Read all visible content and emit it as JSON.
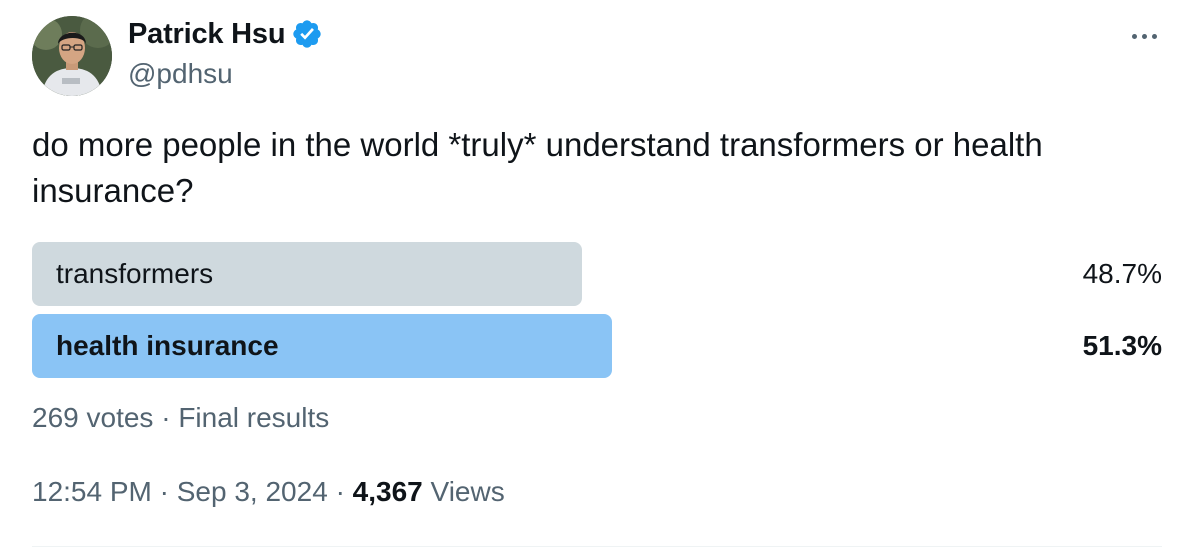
{
  "author": {
    "display_name": "Patrick Hsu",
    "handle": "@pdhsu",
    "verified": true,
    "verified_color": "#1d9bf0"
  },
  "tweet": {
    "text": "do more people in the world *truly* understand transformers or health insurance?"
  },
  "poll": {
    "options": [
      {
        "label": "transformers",
        "percent": "48.7%",
        "share": 0.487,
        "winner": false,
        "color": "#cfd9de"
      },
      {
        "label": "health insurance",
        "percent": "51.3%",
        "share": 0.513,
        "winner": true,
        "color": "#8ac4f5"
      }
    ],
    "votes": "269 votes",
    "separator": "·",
    "status": "Final results"
  },
  "meta": {
    "time": "12:54 PM",
    "date": "Sep 3, 2024",
    "views_count": "4,367",
    "views_label": "Views",
    "separator": "·"
  },
  "icons": {
    "more": "more-horizontal-icon",
    "verified": "verified-badge-icon"
  }
}
